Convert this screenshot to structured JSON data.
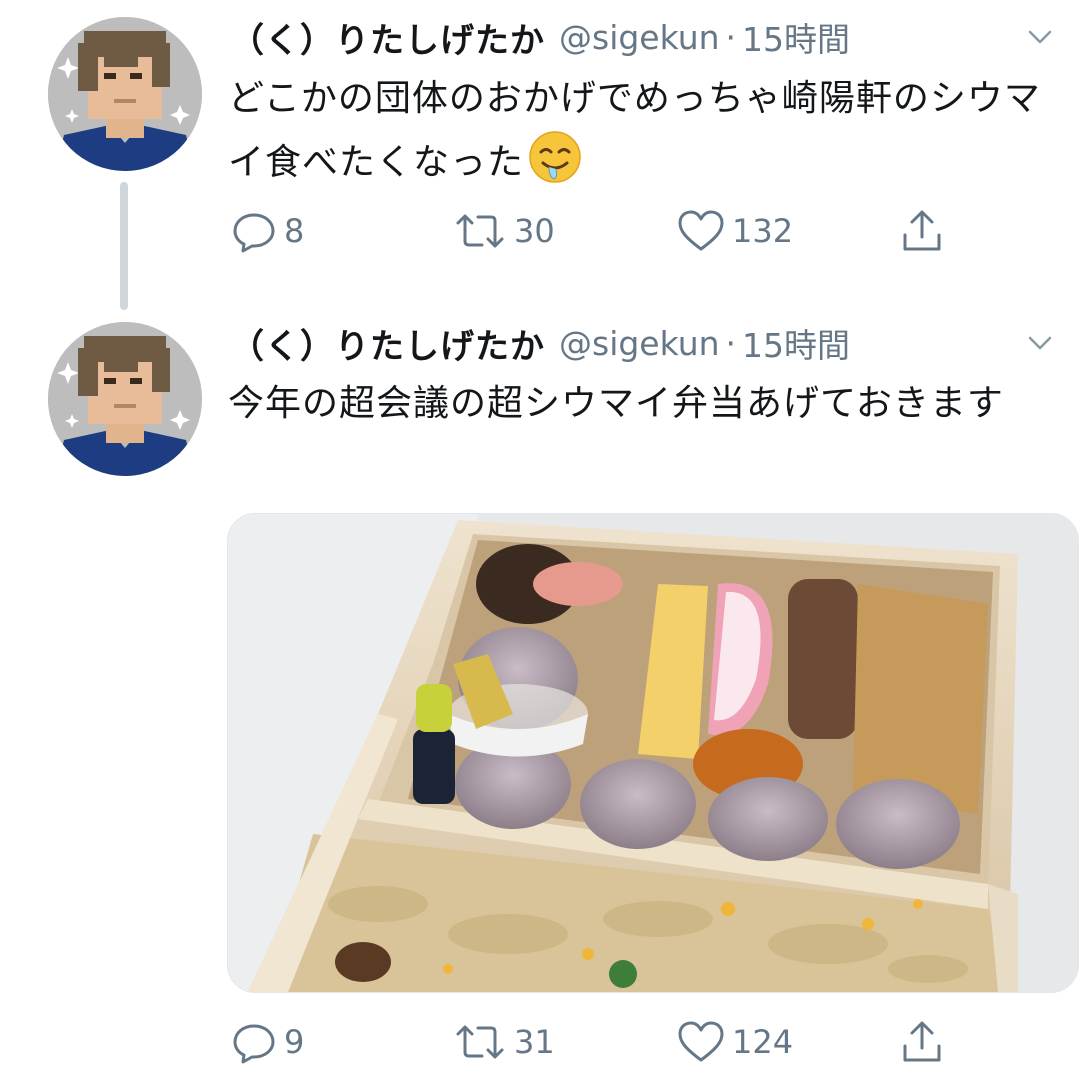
{
  "tweets": [
    {
      "display_name": "（く）りたしげたか",
      "handle": "@sigekun",
      "separator": "·",
      "time": "15時間",
      "text": "どこかの団体のおかげでめっちゃ崎陽軒のシウマイ食べたくなった",
      "emoji_icon": "drooling-face-icon",
      "reply_count": "8",
      "retweet_count": "30",
      "like_count": "132"
    },
    {
      "display_name": "（く）りたしげたか",
      "handle": "@sigekun",
      "separator": "·",
      "time": "15時間",
      "text": "今年の超会議の超シウマイ弁当あげておきます",
      "media_icon": "bento-photo",
      "reply_count": "9",
      "retweet_count": "31",
      "like_count": "124"
    }
  ],
  "icons": {
    "reply": "reply-icon",
    "retweet": "retweet-icon",
    "like": "heart-icon",
    "share": "share-icon",
    "more": "chevron-down-icon"
  },
  "colors": {
    "text": "#14171a",
    "secondary": "#657786",
    "thread_line": "#cfd6dc"
  }
}
